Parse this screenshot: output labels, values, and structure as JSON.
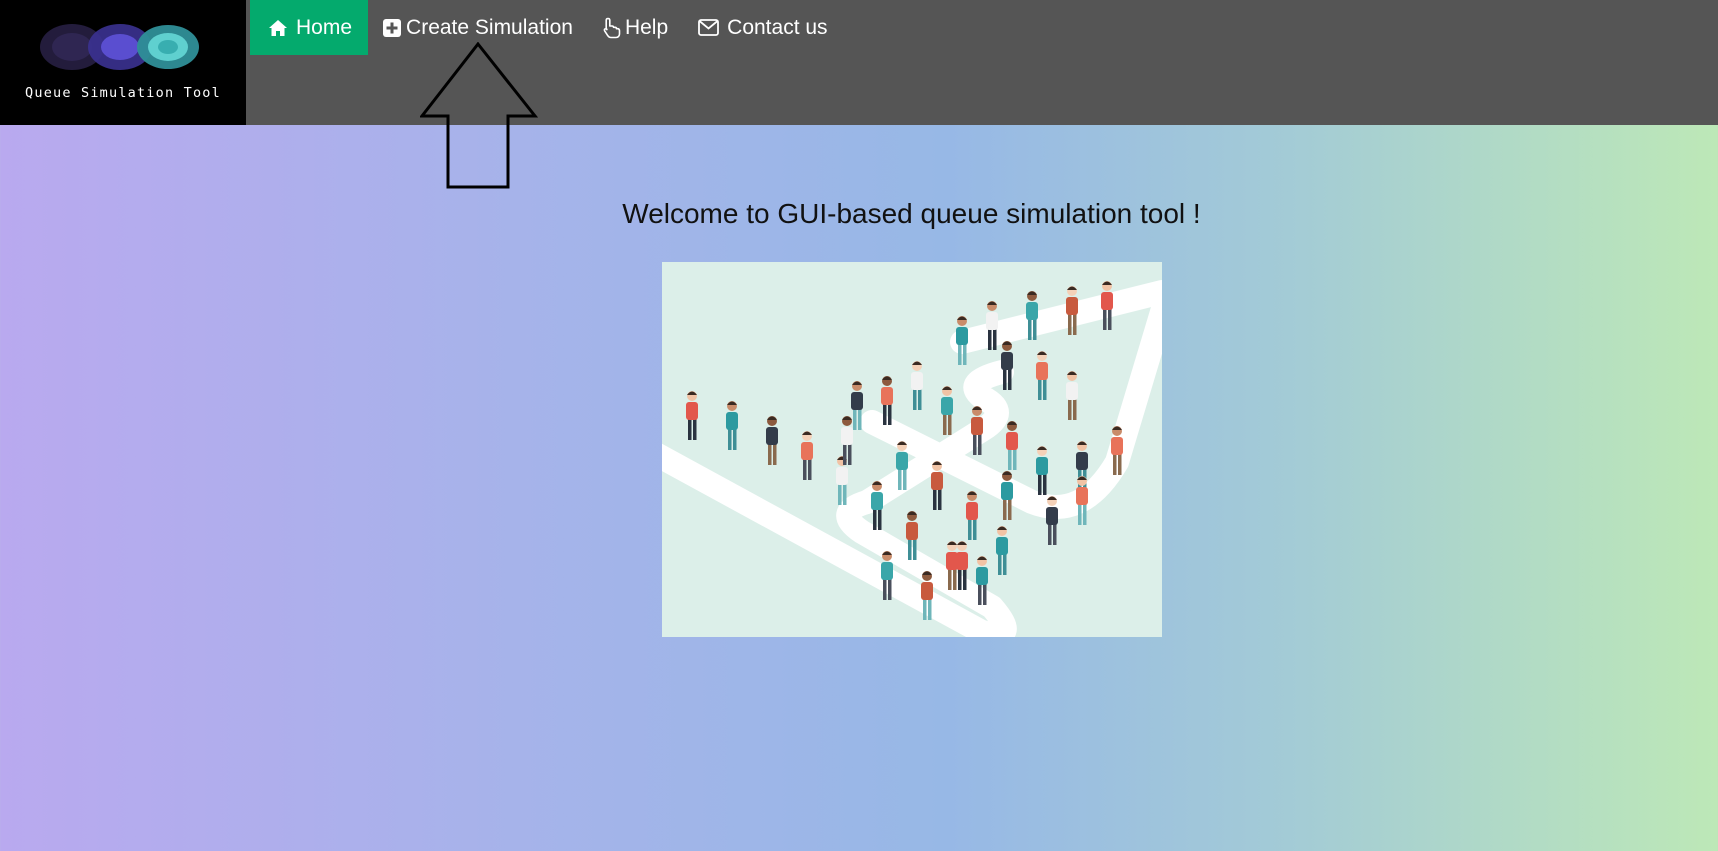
{
  "logo": {
    "text": "Queue Simulation Tool",
    "circle_colors": [
      "#2b2248",
      "#5a4ed0",
      "#46c0c0"
    ]
  },
  "nav": {
    "items": [
      {
        "label": "Home",
        "icon": "home-icon",
        "active": true
      },
      {
        "label": "Create Simulation",
        "icon": "plus-square-icon",
        "active": false
      },
      {
        "label": "Help",
        "icon": "hand-pointer-icon",
        "active": false
      },
      {
        "label": "Contact us",
        "icon": "envelope-icon",
        "active": false
      }
    ],
    "bar_color": "#555555",
    "active_color": "#04aa6d"
  },
  "main": {
    "welcome_text": "Welcome to GUI-based queue simulation tool !"
  },
  "hero_image": {
    "description_icon": "people-queue-illustration"
  },
  "annotation": {
    "icon": "up-arrow-annotation"
  }
}
